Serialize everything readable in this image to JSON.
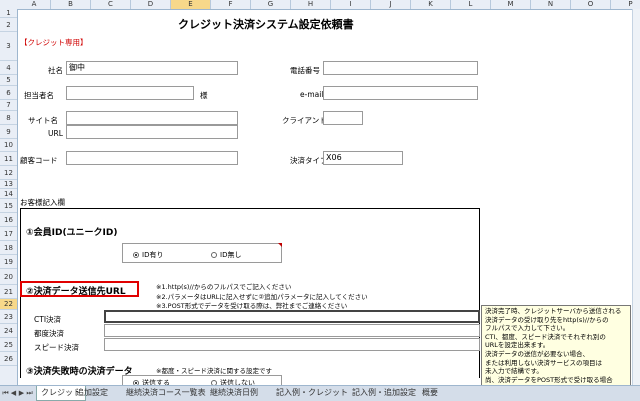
{
  "columns": [
    "A",
    "B",
    "C",
    "D",
    "E",
    "F",
    "G",
    "H",
    "I",
    "J",
    "K",
    "L",
    "M",
    "N",
    "O",
    "P"
  ],
  "rows": [
    "1",
    "2",
    "3",
    "4",
    "5",
    "6",
    "7",
    "8",
    "9",
    "10",
    "11",
    "12",
    "13",
    "14",
    "15",
    "16",
    "17",
    "18",
    "19",
    "20",
    "21",
    "22",
    "23",
    "24",
    "25",
    "26"
  ],
  "doc_title": "クレジット決済システム設定依頼書",
  "credit_only": "【クレジット専用】",
  "labels": {
    "company": "社名",
    "company_suffix": "御中",
    "tel": "電話番号",
    "person": "担当者名",
    "sama": "様",
    "email": "e-mail",
    "site": "サイト名",
    "client_ip": "クライアントIP",
    "url": "URL",
    "customer_code": "顧客コード",
    "settle_type": "決済タイプ",
    "settle_type_value": "X06",
    "customer_fill": "お客様記入欄"
  },
  "section1": {
    "title": "①会員ID(ユニークID)",
    "opt1": "ID有り",
    "opt2": "ID無し"
  },
  "section2": {
    "title": "②決済データ送信先URL",
    "note1": "※1.http(s)//からのフルパスでご記入ください",
    "note2": "※2.パラメータはURLに記入せずに②追加パラメータに記入してください",
    "note3": "※3.POST形式でデータを受け取る際は、弊社までご連絡ください",
    "cti": "CTI決済",
    "tsudo": "都度決済",
    "speed": "スピード決済"
  },
  "section3": {
    "title": "③決済失敗時の決済データ",
    "note": "※都度・スピード決済に関する設定です",
    "opt1": "送信する",
    "opt2": "送信しない"
  },
  "tooltip": {
    "l1": "決済完了時、クレジットサーバから送信される",
    "l2": "決済データの受け取り先をhttp(s)//からの",
    "l3": "フルパスで入力して下さい。",
    "l4": "CTI、都度、スピード決済でそれぞれ別の",
    "l5": "URLを設定出来ます。",
    "l6": "決済データの送信が必要ない場合、",
    "l7": "または利用しない決済サービスの項目は",
    "l8": "未入力で結構です。",
    "l9": "尚、決済データをPOST形式で受け取る場合"
  },
  "tabs": [
    "クレジット",
    "追加設定",
    "継続決済コース一覧表",
    "継続決済日例",
    "記入例・クレジット",
    "記入例・追加設定",
    "概要"
  ]
}
